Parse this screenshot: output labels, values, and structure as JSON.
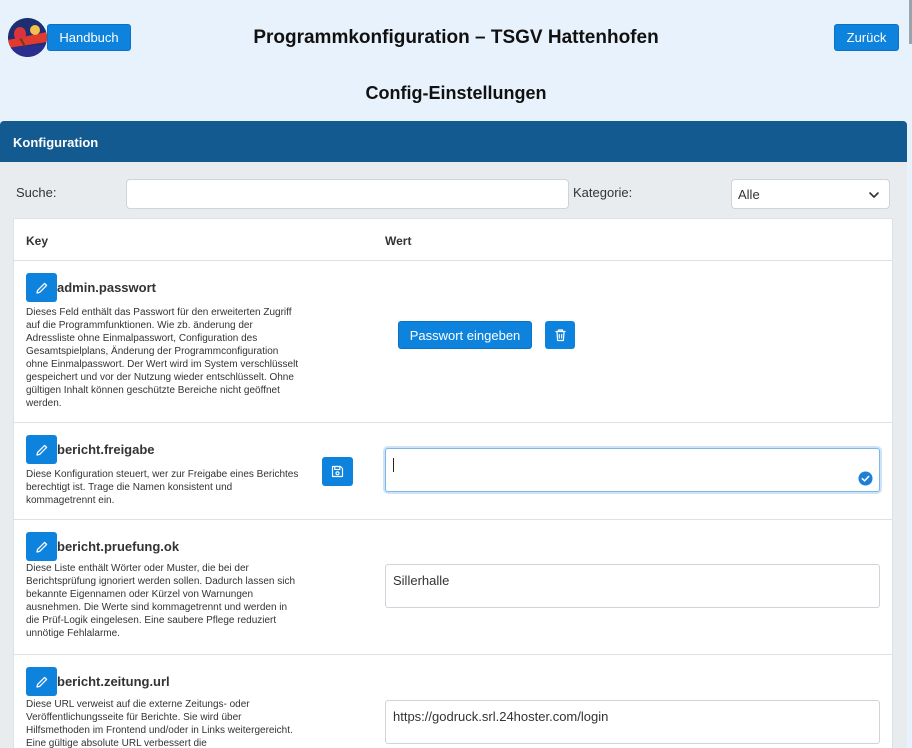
{
  "header": {
    "handbook_label": "Handbuch",
    "title": "Programmkonfiguration – TSGV Hattenhofen",
    "back_label": "Zurück",
    "subtitle": "Config-Einstellungen"
  },
  "card": {
    "title": "Konfiguration",
    "search_label": "Suche:",
    "search_value": "",
    "category_label": "Kategorie:",
    "category_selected": "Alle"
  },
  "table": {
    "col_key": "Key",
    "col_value": "Wert",
    "rows": [
      {
        "key": "admin.passwort",
        "description": "Dieses Feld enthält das Passwort für den erweiterten Zugriff auf die Programmfunktionen. Wie zb. änderung der Adressliste ohne Einmalpasswort, Configuration des Gesamtspielplans, Änderung der Programmconfiguration ohne Einmalpasswort. Der Wert wird im System verschlüsselt gespeichert und vor der Nutzung wieder entschlüsselt. Ohne gültigen Inhalt können geschützte Bereiche nicht geöffnet werden.",
        "action_label": "Passwort eingeben"
      },
      {
        "key": "bericht.freigabe",
        "description": "Diese Konfiguration steuert, wer zur Freigabe eines Berichtes berechtigt ist. Trage die Namen konsistent und kommagetrennt ein.",
        "value": ""
      },
      {
        "key": "bericht.pruefung.ok",
        "description": "Diese Liste enthält Wörter oder Muster, die bei der Berichtsprüfung ignoriert werden sollen. Dadurch lassen sich bekannte Eigennamen oder Kürzel von Warnungen ausnehmen. Die Werte sind kommagetrennt und werden in die Prüf-Logik eingelesen. Eine saubere Pflege reduziert unnötige Fehlalarme.",
        "value": "Sillerhalle"
      },
      {
        "key": "bericht.zeitung.url",
        "description": "Diese URL verweist auf die externe Zeitungs- oder Veröffentlichungsseite für Berichte. Sie wird über Hilfsmethoden im Frontend und/oder in Links weitergereicht. Eine gültige absolute URL verbessert die",
        "value": "https://godruck.srl.24hoster.com/login"
      }
    ]
  },
  "colors": {
    "page_bg": "#e8f2fc",
    "primary": "#0d83dd",
    "card_header": "#125a8f"
  }
}
